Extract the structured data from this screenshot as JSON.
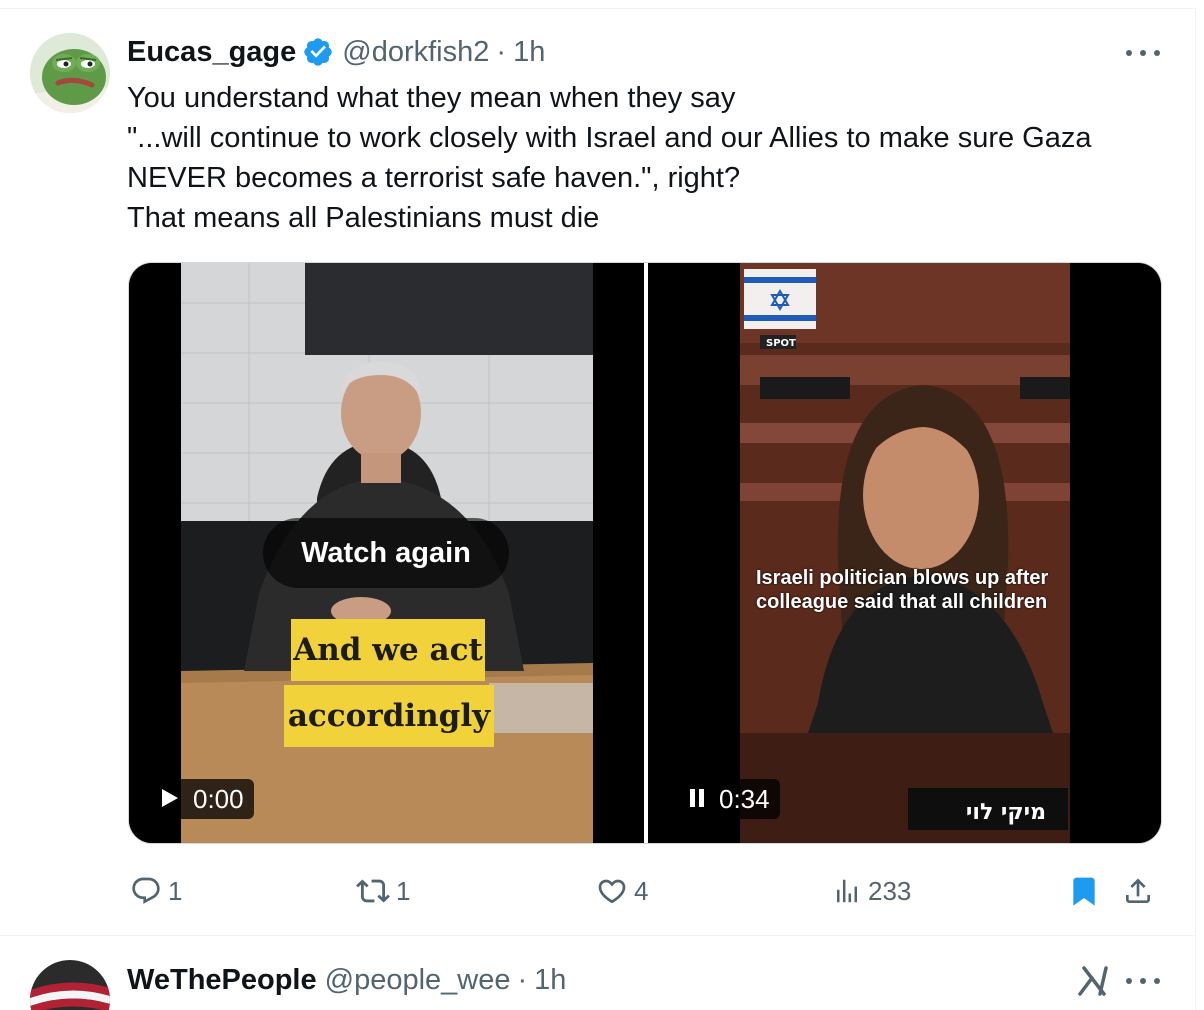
{
  "tweet": {
    "display_name": "Eucas_gage",
    "handle": "@dorkfish2",
    "separator": "·",
    "time": "1h",
    "text_lines": [
      "You understand what they mean when they say",
      "\"...will continue to work closely with Israel and our Allies to make sure Gaza",
      "NEVER becomes a terrorist safe haven.\", right?",
      "That means all Palestinians must die"
    ],
    "videos": [
      {
        "overlay_button": "Watch again",
        "captions": [
          "And we act",
          "accordingly"
        ],
        "playback_icon": "play-icon",
        "time": "0:00"
      },
      {
        "overlay_caption": "Israeli politician blows up after colleague said that all children",
        "playback_icon": "pause-icon",
        "time": "0:34",
        "watermark": "SPOT",
        "nameplate": "מיקי לוי"
      }
    ],
    "actions": {
      "replies": "1",
      "reposts": "1",
      "likes": "4",
      "views": "233",
      "bookmarked": true
    }
  },
  "next_tweet": {
    "display_name": "WeThePeople",
    "handle": "@people_wee",
    "separator": "·",
    "time": "1h"
  },
  "colors": {
    "text_primary": "#0f1419",
    "text_secondary": "#536471",
    "brand_blue": "#1d9bf0",
    "caption_yellow": "#f2d23a",
    "border": "#cfd9de"
  }
}
